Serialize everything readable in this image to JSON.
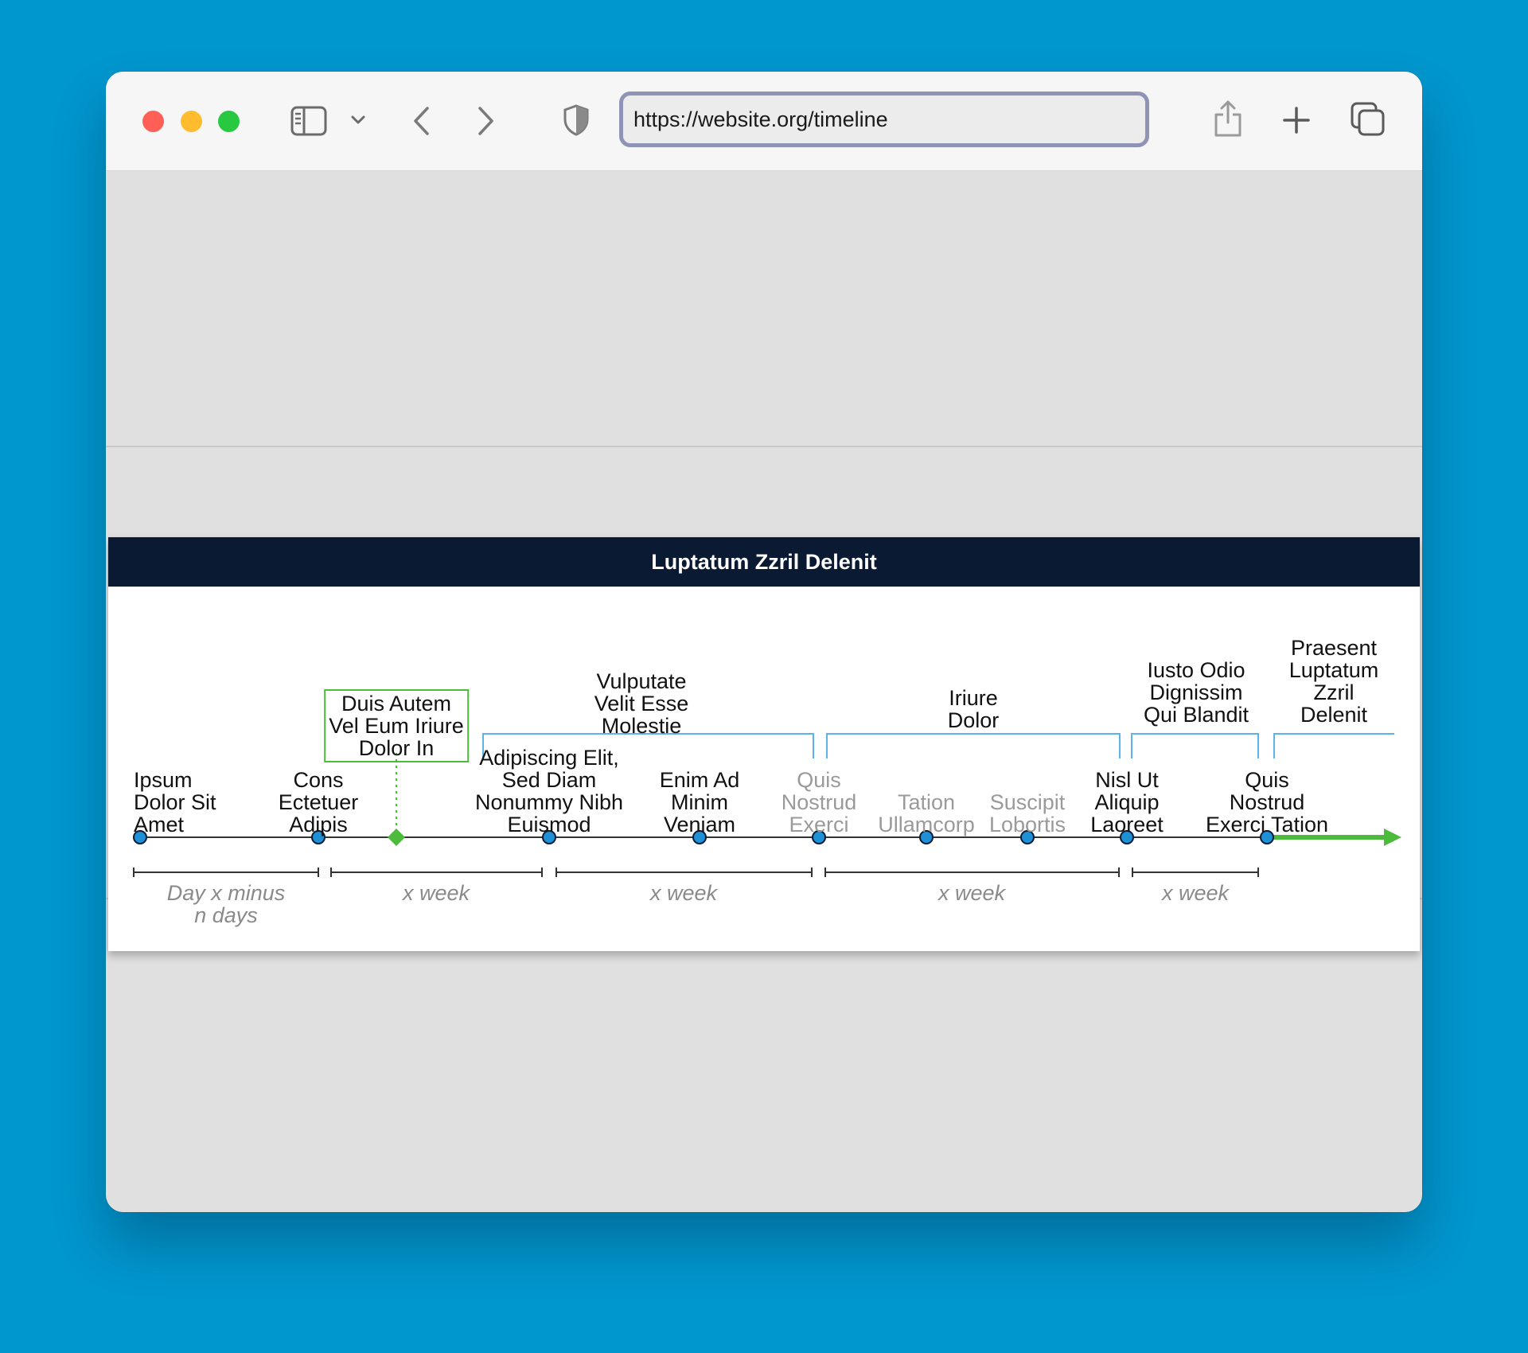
{
  "browser": {
    "url": "https://website.org/timeline",
    "icons": [
      "close-button",
      "minimize-button",
      "zoom-button",
      "sidebar-icon",
      "chevron-down-icon",
      "back-icon",
      "forward-icon",
      "shield-icon",
      "share-icon",
      "plus-icon",
      "tabs-icon"
    ]
  },
  "timeline": {
    "title": "Luptatum Zzril Delenit",
    "colors": {
      "header": "#0b1a33",
      "milestone": "#1e90d6",
      "highlight": "#4cbb3c",
      "bracket": "#5ab4e8"
    },
    "highlight": [
      "Duis Autem",
      "Vel Eum Iriure",
      "Dolor In"
    ],
    "events": [
      {
        "lines": [
          "Ipsum",
          "Dolor Sit",
          "Amet"
        ],
        "muted": false
      },
      {
        "lines": [
          "Cons",
          "Ectetuer",
          "Adipis"
        ],
        "muted": false
      },
      {
        "lines": [
          "Adipiscing Elit,",
          "Sed Diam",
          "Nonummy Nibh",
          "Euismod"
        ],
        "muted": false
      },
      {
        "lines": [
          "Enim Ad",
          "Minim",
          "Veniam"
        ],
        "muted": false
      },
      {
        "lines": [
          "Quis",
          "Nostrud",
          "Exerci"
        ],
        "muted": true
      },
      {
        "lines": [
          "Tation",
          "Ullamcorp"
        ],
        "muted": true
      },
      {
        "lines": [
          "Suscipit",
          "Lobortis"
        ],
        "muted": true
      },
      {
        "lines": [
          "Nisl Ut",
          "Aliquip",
          "Laoreet"
        ],
        "muted": false
      },
      {
        "lines": [
          "Quis",
          "Nostrud",
          "Exerci Tation"
        ],
        "muted": false
      }
    ],
    "phases": [
      {
        "lines": [
          "Vulputate",
          "Velit Esse",
          "Molestie"
        ]
      },
      {
        "lines": [
          "Iriure",
          "Dolor"
        ]
      },
      {
        "lines": [
          "Iusto Odio",
          "Dignissim",
          "Qui Blandit"
        ]
      },
      {
        "lines": [
          "Praesent",
          "Luptatum",
          "Zzril",
          "Delenit"
        ]
      }
    ],
    "intervals": [
      {
        "lines": [
          "Day x minus",
          "n days"
        ]
      },
      {
        "lines": [
          "x week"
        ]
      },
      {
        "lines": [
          "x week"
        ]
      },
      {
        "lines": [
          "x week"
        ]
      },
      {
        "lines": [
          "x week"
        ]
      }
    ]
  }
}
